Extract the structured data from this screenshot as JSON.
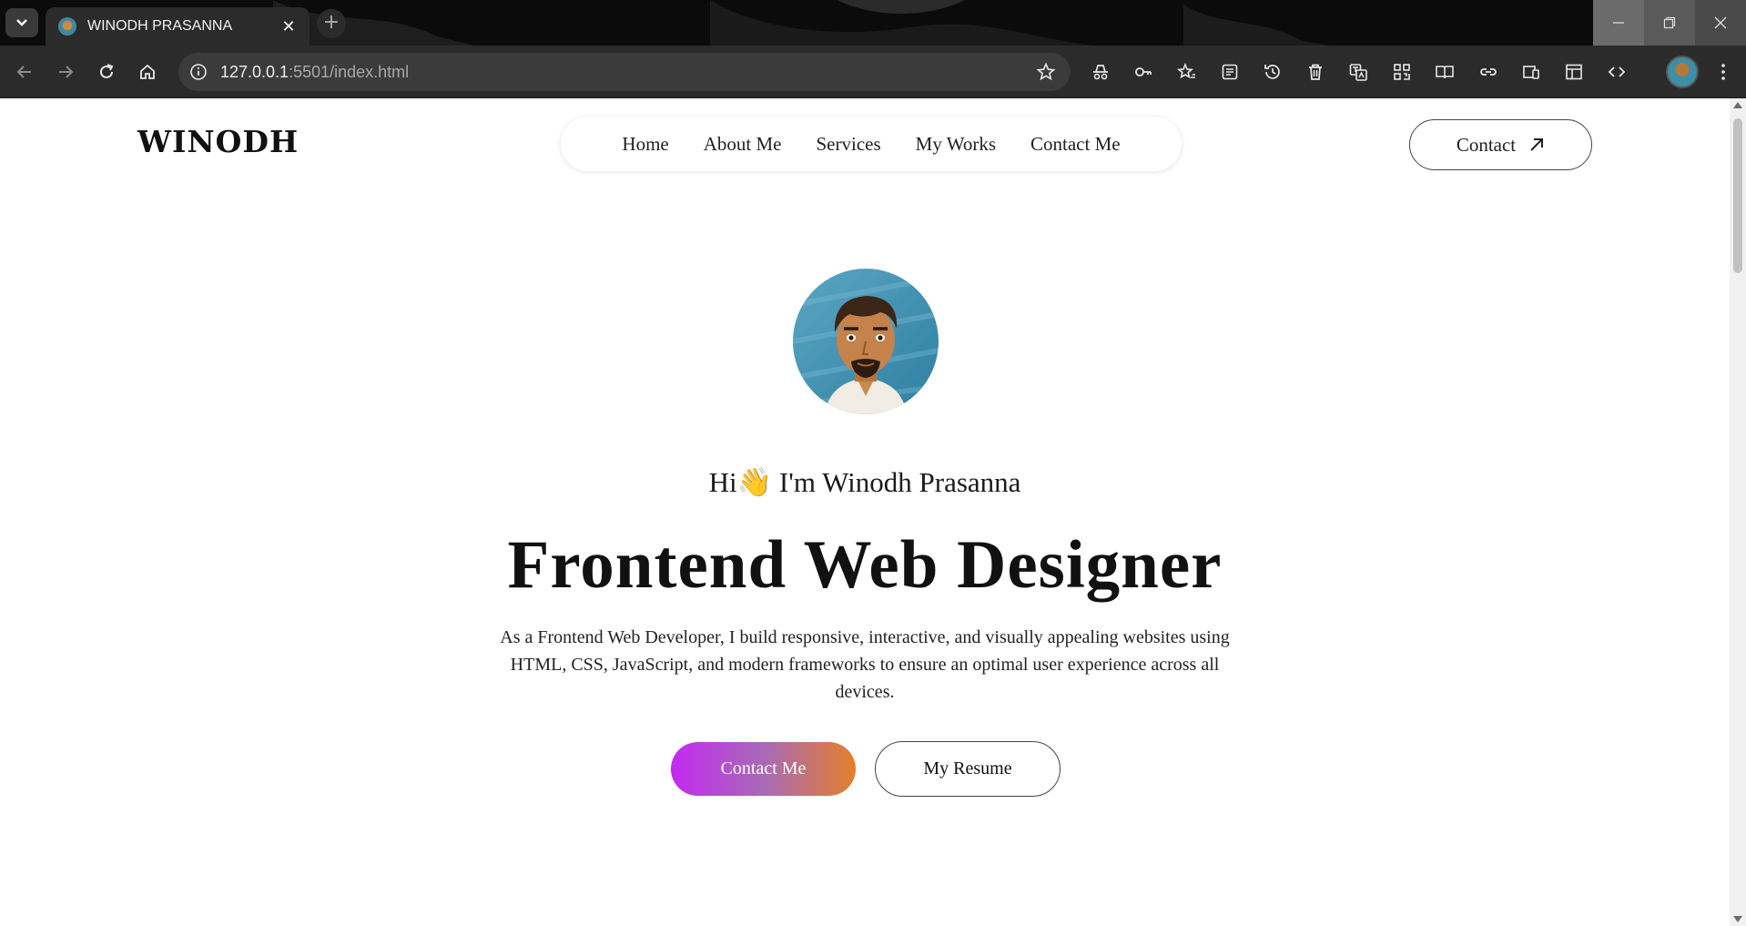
{
  "browser": {
    "tab_title": "WINODH PRASANNA",
    "tab_close": "✕",
    "new_tab": "+",
    "url_host": "127.0.0.1",
    "url_rest": ":5501/index.html"
  },
  "site": {
    "logo": "WINODH",
    "nav": [
      "Home",
      "About Me",
      "Services",
      "My Works",
      "Contact Me"
    ],
    "contact_button": "Contact"
  },
  "hero": {
    "greeting": "Hi👋 I'm Winodh Prasanna",
    "headline": "Frontend Web Designer",
    "description": "As a Frontend Web Developer, I build responsive, interactive, and visually appealing websites using HTML, CSS, JavaScript, and modern frameworks to ensure an optimal user experience across all devices.",
    "primary_button": "Contact Me",
    "secondary_button": "My Resume"
  },
  "colors": {
    "gradient_start": "#c429f0",
    "gradient_end": "#e47f2a",
    "chrome_dark": "#2b2b2b"
  }
}
